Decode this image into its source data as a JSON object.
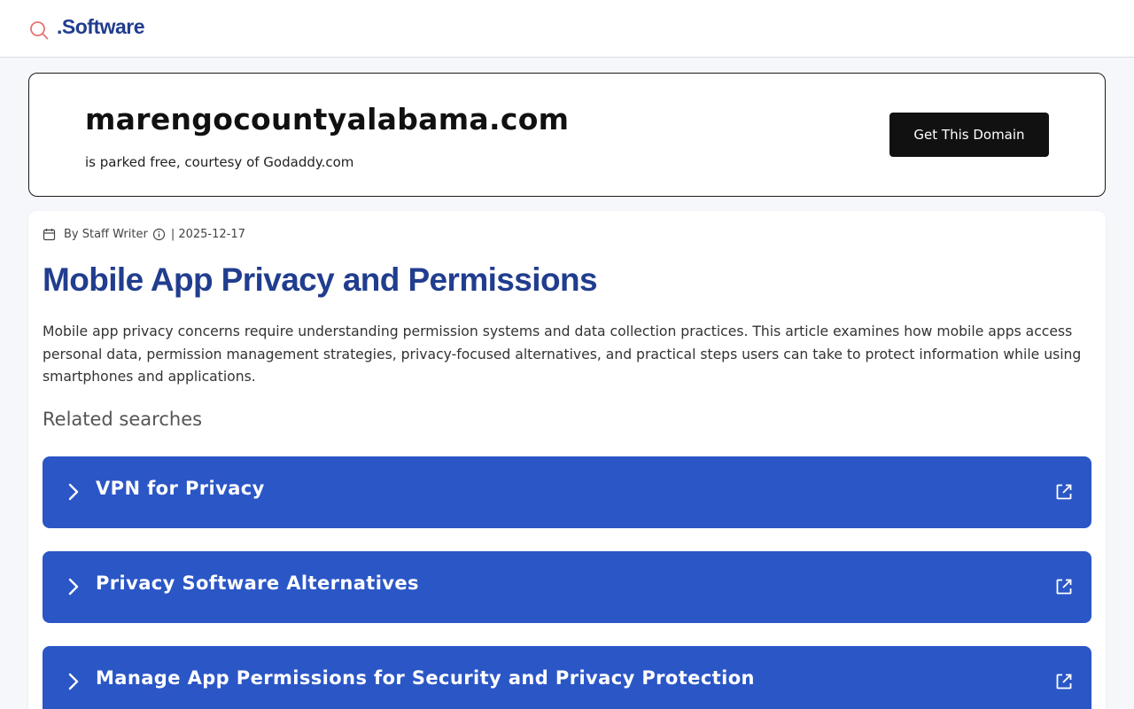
{
  "header": {
    "logo_text": ".Software",
    "logo_icon": "search-icon",
    "accent_color": "#e57373",
    "brand_color": "#213d8e"
  },
  "domain_banner": {
    "domain": "marengocountyalabama.com",
    "subtitle": "is parked free, courtesy of Godaddy.com",
    "cta_label": "Get This Domain"
  },
  "article": {
    "author": "By Staff Writer",
    "date": "| 2025-12-17",
    "title": "Mobile App Privacy and Permissions",
    "summary": "Mobile app privacy concerns require understanding permission systems and data collection practices. This article examines how mobile apps access personal data, permission management strategies, privacy-focused alternatives, and practical steps users can take to protect information while using smartphones and applications.",
    "related_heading": "Related searches",
    "related": [
      {
        "label": "VPN for Privacy"
      },
      {
        "label": "Privacy Software Alternatives"
      },
      {
        "label": "Manage App Permissions for Security and Privacy Protection"
      }
    ],
    "related_color": "#2b56c6"
  }
}
